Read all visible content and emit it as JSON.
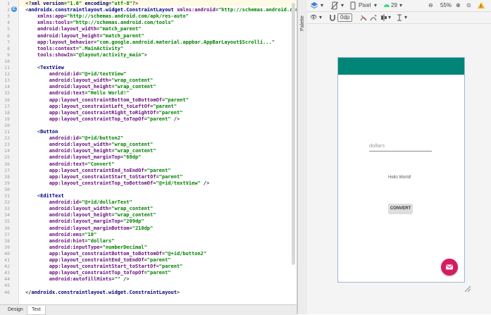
{
  "editor": {
    "lines": [
      {
        "n": "1",
        "html": "<span class='punc'>&lt;?</span><span class='tag'>xml version</span><span class='punc'>=</span><span class='val'>\"1.0\"</span> <span class='tag'>encoding</span><span class='punc'>=</span><span class='val'>\"utf-8\"</span><span class='punc'>?&gt;</span>"
      },
      {
        "n": "2",
        "html": "<span class='punc'>&lt;</span><span class='tag'>androidx.constraintlayout.widget.ConstraintLayout</span> <span class='attr'>xmlns:android</span>=<span class='val'>\"http://schemas.android.com</span>"
      },
      {
        "n": "3",
        "html": "    <span class='attr'>xmlns:app</span>=<span class='val'>\"http://schemas.android.com/apk/res-auto\"</span>"
      },
      {
        "n": "4",
        "html": "    <span class='attr'>xmlns:tools</span>=<span class='val'>\"http://schemas.android.com/tools\"</span>"
      },
      {
        "n": "5",
        "html": "    <span class='attr'>android:layout_width</span>=<span class='val'>\"match_parent\"</span>"
      },
      {
        "n": "6",
        "html": "    <span class='attr'>android:layout_height</span>=<span class='val'>\"match_parent\"</span>"
      },
      {
        "n": "7",
        "html": "    <span class='attr'>app:layout_behavior</span>=<span class='val'>\"com.google.android.material.appbar.AppBarLayout$Scrolli...\"</span>"
      },
      {
        "n": "8",
        "html": "    <span class='attr'>tools:context</span>=<span class='val'>\".MainActivity\"</span>"
      },
      {
        "n": "9",
        "html": "    <span class='attr'>tools:showIn</span>=<span class='val'>\"@layout/activity_main\"</span>&gt;"
      },
      {
        "n": "10",
        "html": ""
      },
      {
        "n": "11",
        "html": "    &lt;<span class='tag'>TextView</span>"
      },
      {
        "n": "12",
        "html": "        <span class='attr'>android:id</span>=<span class='val'>\"@+id/textView\"</span>"
      },
      {
        "n": "13",
        "html": "        <span class='attr'>android:layout_width</span>=<span class='val'>\"wrap_content\"</span>"
      },
      {
        "n": "14",
        "html": "        <span class='attr'>android:layout_height</span>=<span class='val'>\"wrap_content\"</span>"
      },
      {
        "n": "15",
        "html": "        <span class='attr'>android:text</span>=<span class='val'>\"Hello World!\"</span>"
      },
      {
        "n": "16",
        "html": "        <span class='attr'>app:layout_constraintBottom_toBottomOf</span>=<span class='val'>\"parent\"</span>"
      },
      {
        "n": "17",
        "html": "        <span class='attr'>app:layout_constraintLeft_toLeftOf</span>=<span class='val'>\"parent\"</span>"
      },
      {
        "n": "18",
        "html": "        <span class='attr'>app:layout_constraintRight_toRightOf</span>=<span class='val'>\"parent\"</span>"
      },
      {
        "n": "19",
        "html": "        <span class='attr'>app:layout_constraintTop_toTopOf</span>=<span class='val'>\"parent\"</span> /&gt;"
      },
      {
        "n": "20",
        "html": ""
      },
      {
        "n": "21",
        "html": "    &lt;<span class='tag'>Button</span>"
      },
      {
        "n": "22",
        "html": "        <span class='attr'>android:id</span>=<span class='val'>\"@+id/button2\"</span>"
      },
      {
        "n": "23",
        "html": "        <span class='attr'>android:layout_width</span>=<span class='val'>\"wrap_content\"</span>"
      },
      {
        "n": "24",
        "html": "        <span class='attr'>android:layout_height</span>=<span class='val'>\"wrap_content\"</span>"
      },
      {
        "n": "25",
        "html": "        <span class='attr'>android:layout_marginTop</span>=<span class='val'>\"68dp\"</span>"
      },
      {
        "n": "26",
        "html": "        <span class='attr'>android:text</span>=<span class='val'>\"Convert\"</span>"
      },
      {
        "n": "27",
        "html": "        <span class='attr'>app:layout_constraintEnd_toEndOf</span>=<span class='val'>\"parent\"</span>"
      },
      {
        "n": "28",
        "html": "        <span class='attr'>app:layout_constraintStart_toStartOf</span>=<span class='val'>\"parent\"</span>"
      },
      {
        "n": "29",
        "html": "        <span class='attr'>app:layout_constraintTop_toBottomOf</span>=<span class='val'>\"@+id/textView\"</span> /&gt;"
      },
      {
        "n": "30",
        "html": ""
      },
      {
        "n": "31",
        "html": "    &lt;<span class='tag'>EditText</span>"
      },
      {
        "n": "32",
        "html": "        <span class='attr'>android:id</span>=<span class='val'>\"@+id/dollarText\"</span>"
      },
      {
        "n": "33",
        "html": "        <span class='attr'>android:layout_width</span>=<span class='val'>\"wrap_content\"</span>"
      },
      {
        "n": "34",
        "html": "        <span class='attr'>android:layout_height</span>=<span class='val'>\"wrap_content\"</span>"
      },
      {
        "n": "35",
        "html": "        <span class='attr'>android:layout_marginTop</span>=<span class='val'>\"209dp\"</span>"
      },
      {
        "n": "36",
        "html": "        <span class='attr'>android:layout_marginBottom</span>=<span class='val'>\"210dp\"</span>"
      },
      {
        "n": "37",
        "html": "        <span class='attr'>android:ems</span>=<span class='val'>\"10\"</span>"
      },
      {
        "n": "38",
        "html": "        <span class='attr'>android:hint</span>=<span class='val'>\"dollars\"</span>"
      },
      {
        "n": "39",
        "html": "        <span class='attr'>android:inputType</span>=<span class='val'>\"numberDecimal\"</span>"
      },
      {
        "n": "40",
        "html": "        <span class='attr'>app:layout_constraintBottom_toBottomOf</span>=<span class='val'>\"@+id/button2\"</span>"
      },
      {
        "n": "41",
        "html": "        <span class='attr'>app:layout_constraintEnd_toEndOf</span>=<span class='val'>\"parent\"</span>"
      },
      {
        "n": "42",
        "html": "        <span class='attr'>app:layout_constraintStart_toStartOf</span>=<span class='val'>\"parent\"</span>"
      },
      {
        "n": "43",
        "html": "        <span class='attr'>app:layout_constraintTop_toTopOf</span>=<span class='val'>\"parent\"</span>"
      },
      {
        "n": "44",
        "html": "        <span class='attr'>android:autofillHints</span>=<span class='val'>\"\"</span> /&gt;"
      },
      {
        "n": "45",
        "html": ""
      },
      {
        "n": "46",
        "html": "&lt;/<span class='tag'>androidx.constraintlayout.widget.ConstraintLayout</span>&gt;"
      }
    ]
  },
  "tabs": {
    "design": "Design",
    "text": "Text"
  },
  "palette_label": "Palette",
  "toolbar": {
    "device": "Pixel",
    "api": "29",
    "zoom": "55%",
    "margin": "0dp"
  },
  "preview": {
    "hint": "dollars",
    "hello": "Hello World!",
    "convert": "CONVERT"
  },
  "colors": {
    "appbar": "#008577",
    "fab": "#D81B60"
  }
}
